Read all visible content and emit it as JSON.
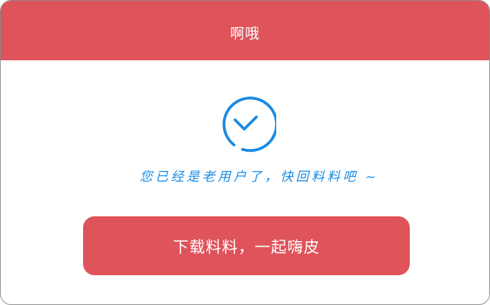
{
  "dialog": {
    "title": "啊哦",
    "status_icon": "check-circle-icon",
    "message": "您已经是老用户了，快回料料吧 ~",
    "primary_button_label": "下载料料，一起嗨皮"
  },
  "colors": {
    "brand_red": "#df535b",
    "accent_blue": "#1a8be4",
    "text_on_brand": "#ffffff"
  }
}
